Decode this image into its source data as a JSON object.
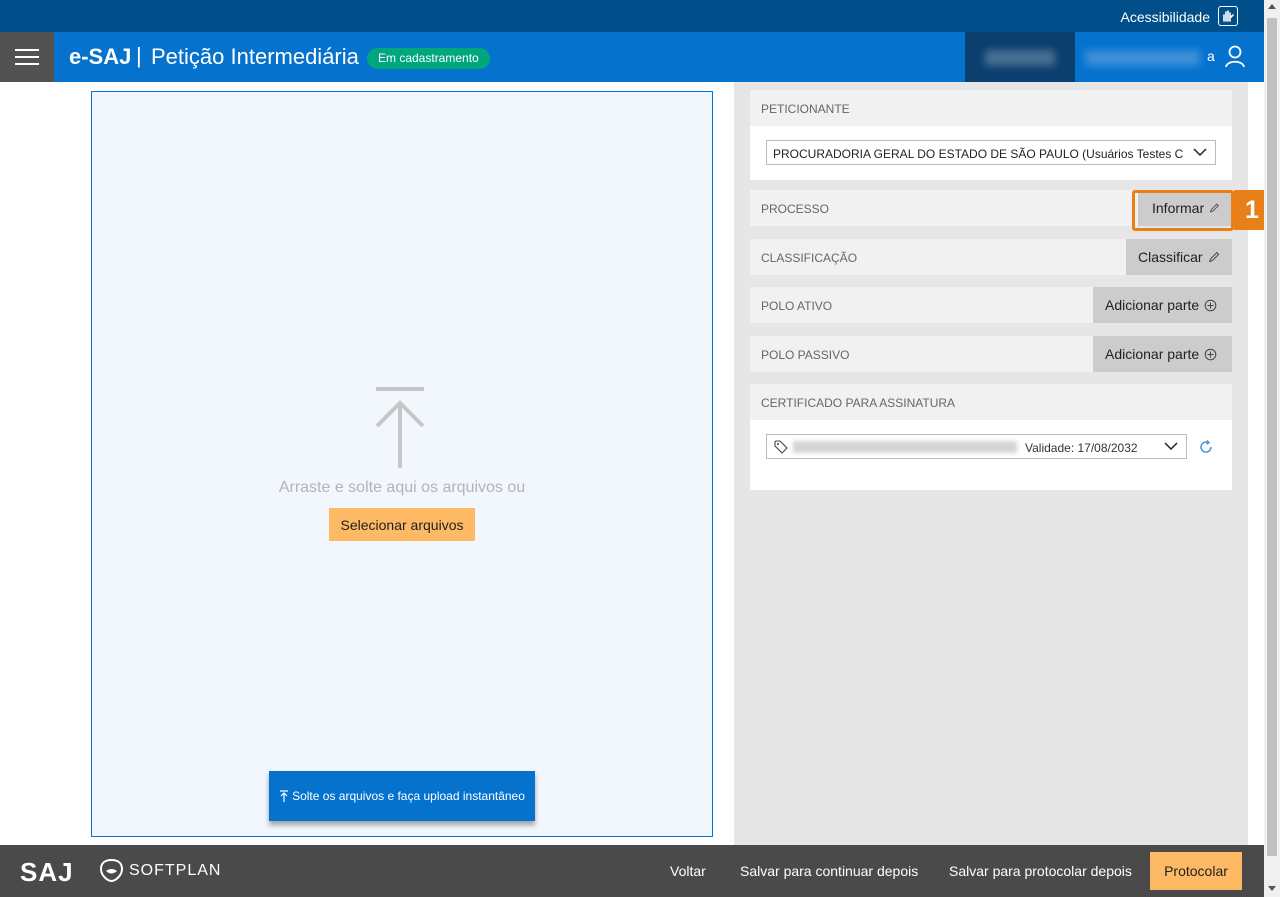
{
  "accessibility": {
    "label": "Acessibilidade"
  },
  "header": {
    "brand": "e-SAJ",
    "separator": "|",
    "title": "Petição Intermediária",
    "status_badge": "Em cadastramento",
    "user_name_tail": "a"
  },
  "upload": {
    "drop_text": "Arraste e solte aqui os arquivos ou",
    "select_label": "Selecionar arquivos",
    "instant_label": "Solte os arquivos e faça upload instantâneo"
  },
  "panel": {
    "peticionante": {
      "title": "PETICIONANTE",
      "selected": "PROCURADORIA GERAL DO ESTADO DE SÃO PAULO (Usuários Testes Cna - Procuradoria)"
    },
    "processo": {
      "title": "PROCESSO",
      "button": "Informar"
    },
    "classificacao": {
      "title": "CLASSIFICAÇÃO",
      "button": "Classificar"
    },
    "polo_ativo": {
      "title": "POLO ATIVO",
      "button": "Adicionar parte"
    },
    "polo_passivo": {
      "title": "POLO PASSIVO",
      "button": "Adicionar parte"
    },
    "certificado": {
      "title": "CERTIFICADO PARA ASSINATURA",
      "validity": "Validade: 17/08/2032"
    }
  },
  "annotation": {
    "number": "1",
    "color": "#e8801a"
  },
  "footer": {
    "logo": "SAJ",
    "softplan": "SOFTPLAN",
    "back": "Voltar",
    "save_continue": "Salvar para continuar depois",
    "save_protocol": "Salvar para protocolar depois",
    "protocol": "Protocolar"
  },
  "colors": {
    "brand_blue": "#0572ce",
    "top_bar": "#004f8b",
    "accent_orange": "#fdb964",
    "badge_green": "#00a67e"
  }
}
